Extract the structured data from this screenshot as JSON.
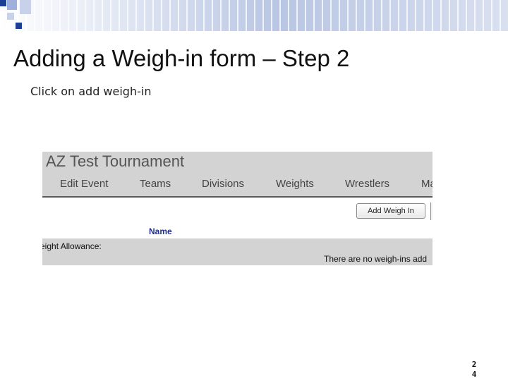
{
  "slide": {
    "title": "Adding a Weigh-in form – Step 2",
    "bullet": "Click on add weigh-in",
    "page_number_digits": [
      "2",
      "4"
    ]
  },
  "screenshot": {
    "tournament_title": "AZ Test Tournament",
    "nav": [
      "Edit Event",
      "Teams",
      "Divisions",
      "Weights",
      "Wrestlers",
      "Ma"
    ],
    "add_weigh_in_button": "Add Weigh In",
    "column_header": "Name",
    "weight_allowance_label": "eight Allowance:",
    "empty_message": "There are no weigh-ins add"
  },
  "colors": {
    "header_band": "#d3d3d3",
    "column_header_text": "#1f2f8a",
    "decor_dark": "#1b3f95",
    "decor_light": "#c7d1ea"
  }
}
